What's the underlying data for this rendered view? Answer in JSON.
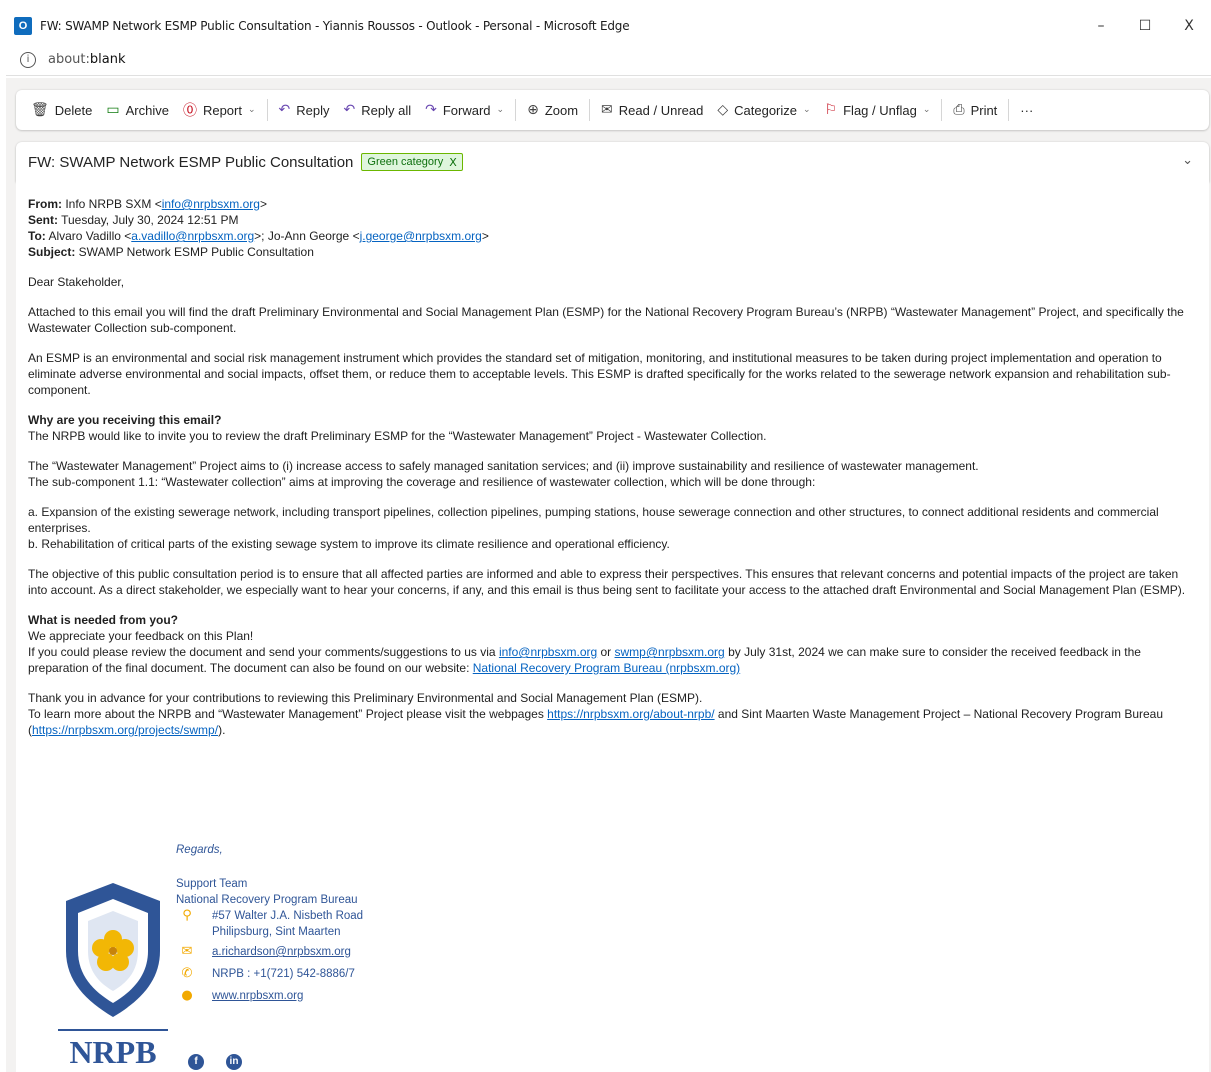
{
  "window": {
    "title": "FW: SWAMP Network ESMP Public Consultation - Yiannis Roussos - Outlook - Personal - Microsoft Edge",
    "app_icon": "O",
    "minimize": "–",
    "maximize": "☐",
    "close": "X"
  },
  "address": {
    "scheme": "about:",
    "host": "blank",
    "info_icon": "i"
  },
  "toolbar": {
    "delete": "Delete",
    "archive": "Archive",
    "report": "Report",
    "reply": "Reply",
    "reply_all": "Reply all",
    "forward": "Forward",
    "zoom": "Zoom",
    "read_unread": "Read / Unread",
    "categorize": "Categorize",
    "flag": "Flag / Unflag",
    "print": "Print",
    "more": "···",
    "icons": {
      "delete": "🗑",
      "archive": "▭",
      "report": "⓪",
      "reply": "↶",
      "reply_all": "↶",
      "forward": "↷",
      "zoom": "⊕",
      "read_unread": "✉",
      "categorize": "◇",
      "flag": "⚐",
      "print": "⎙",
      "chevron": "⌄"
    }
  },
  "subject_bar": {
    "title": "FW: SWAMP Network ESMP Public Consultation",
    "category": "Green category",
    "category_remove": "X",
    "expand": "⌄"
  },
  "email": {
    "from_label": "From:",
    "from_name": " Info NRPB SXM <",
    "from_email": "info@nrpbsxm.org",
    "from_end": ">",
    "sent_label": "Sent:",
    "sent_value": " Tuesday, July 30, 2024 12:51 PM",
    "to_label": "To:",
    "to_name1": " Alvaro Vadillo <",
    "to_email1": "a.vadillo@nrpbsxm.org",
    "to_mid": ">; Jo-Ann George <",
    "to_email2": "j.george@nrpbsxm.org",
    "to_end": ">",
    "subject_label": "Subject:",
    "subject_value": " SWAMP Network ESMP Public Consultation",
    "greeting": "Dear Stakeholder,",
    "p1": "Attached to this email you will find the draft Preliminary Environmental and Social Management Plan (ESMP) for the National Recovery Program Bureau’s (NRPB) “Wastewater Management” Project, and specifically the Wastewater Collection sub-component.",
    "p2": "An ESMP is an environmental and social risk management instrument which provides the standard set of mitigation, monitoring, and institutional measures to be taken during project implementation and operation to eliminate adverse environmental and social impacts, offset them, or reduce them to acceptable levels. This ESMP is drafted specifically for the works related to the sewerage network expansion and rehabilitation sub-component.",
    "h1": "Why are you receiving this email?",
    "p3": "The NRPB would like to invite you to review the draft Preliminary ESMP for the “Wastewater Management” Project - Wastewater Collection.",
    "p4a": "The “Wastewater Management” Project aims to (i) increase access to safely managed sanitation services; and (ii) improve sustainability and resilience of wastewater management.",
    "p4b": "The sub-component 1.1: “Wastewater collection” aims at improving the coverage and resilience of wastewater collection, which will be done through:",
    "p5a": "a. Expansion of the existing sewerage network, including transport pipelines, collection pipelines, pumping stations, house sewerage connection and other structures, to connect additional residents and commercial enterprises.",
    "p5b": "b. Rehabilitation of critical parts of the existing sewage system to improve its climate resilience and operational efficiency.",
    "p6": "The objective of this public consultation period is to ensure that all affected parties are informed and able to express their perspectives. This ensures that relevant concerns and potential impacts of the project are taken into account. As a direct stakeholder, we especially want to hear your concerns, if any, and this email is thus being sent to facilitate your access to the attached draft Environmental and Social Management Plan (ESMP).",
    "h2": "What is needed from you?",
    "p7a": "We appreciate your feedback on this Plan!",
    "p7b_1": "If you could please review the document and send your comments/suggestions to us via ",
    "p7b_link1": "info@nrpbsxm.org",
    "p7b_2": " or ",
    "p7b_link2": "swmp@nrpbsxm.org",
    "p7b_3": " by July 31st, 2024 we can make sure to consider the received feedback in the preparation of the final document. The document can also be found on our website: ",
    "p7b_link3": "National Recovery Program Bureau (nrpbsxm.org)",
    "p8a": "Thank you in advance for your contributions to reviewing this Preliminary Environmental and Social Management Plan (ESMP).",
    "p8b_1": "To learn more about the NRPB and “Wastewater Management” Project please visit the webpages ",
    "p8b_link1": "https://nrpbsxm.org/about-nrpb/",
    "p8b_2": " and Sint Maarten Waste Management Project – National Recovery Program Bureau (",
    "p8b_link2": "https://nrpbsxm.org/projects/swmp/",
    "p8b_3": ")."
  },
  "signature": {
    "regards": "Regards,",
    "team": "Support Team",
    "org": "National Recovery Program Bureau",
    "addr1": "#57 Walter J.A. Nisbeth Road",
    "addr2": "Philipsburg, Sint Maarten",
    "email": "a.richardson@nrpbsxm.org",
    "phone": "NRPB : +1(721) 542-8886/7",
    "website": "www.nrpbsxm.org",
    "logo_text": "NRPB",
    "icons": {
      "location": "⚲",
      "email": "✉",
      "phone": "✆",
      "web": "●"
    },
    "facebook": "f",
    "linkedin": "in",
    "colors": {
      "brand": "#2f5597",
      "accent": "#f2a900"
    }
  }
}
